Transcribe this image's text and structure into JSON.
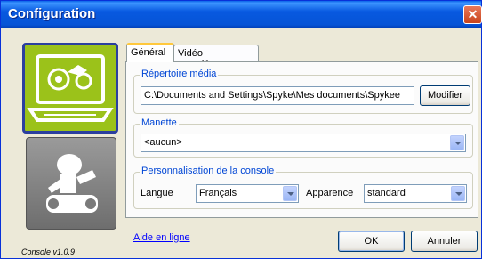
{
  "window": {
    "title": "Configuration",
    "close_glyph": "✕"
  },
  "sidebar": {
    "modes": [
      {
        "name": "console-mode",
        "icon": "laptop-robot-icon",
        "color": "#9bc21a"
      },
      {
        "name": "robot-mode",
        "icon": "spykee-robot-icon",
        "color": "#8a8a8a"
      }
    ],
    "version": "Console v1.0.9",
    "help_link": "Aide en ligne"
  },
  "tabs": [
    {
      "label": "Général",
      "active": true
    },
    {
      "label": "Vidéo surveillance",
      "active": false
    }
  ],
  "general": {
    "media_dir": {
      "label": "Répertoire média",
      "path": "C:\\Documents and Settings\\Spyke\\Mes documents\\Spykee",
      "modify_button": "Modifier"
    },
    "joystick": {
      "label": "Manette",
      "selected": "<aucun>"
    },
    "console_custom": {
      "label": "Personnalisation de la console",
      "language_label": "Langue",
      "language_value": "Français",
      "appearance_label": "Apparence",
      "appearance_value": "standard"
    }
  },
  "footer": {
    "ok_button": "OK",
    "cancel_button": "Annuler"
  }
}
